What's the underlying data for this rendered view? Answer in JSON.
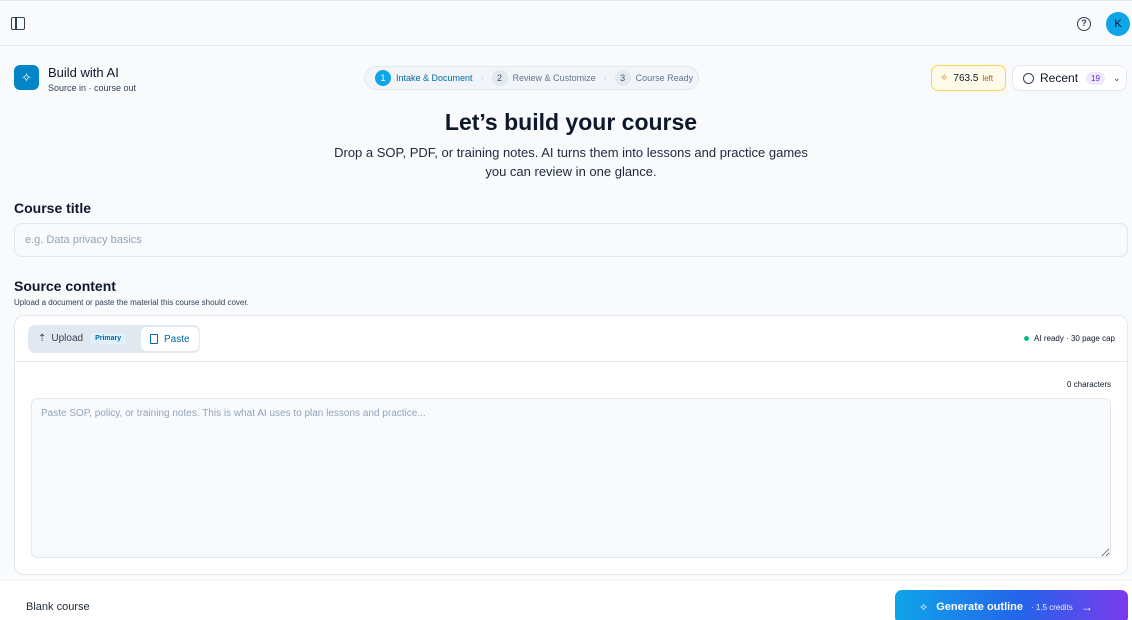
{
  "topbar": {
    "avatar_initial": "K"
  },
  "brand": {
    "title": "Build with AI",
    "subtitle": "Source in · course out"
  },
  "stepper": [
    {
      "num": "1",
      "label": "Intake & Document",
      "active": true
    },
    {
      "num": "2",
      "label": "Review & Customize",
      "active": false
    },
    {
      "num": "3",
      "label": "Course Ready",
      "active": false
    }
  ],
  "credits": {
    "amount": "763.5",
    "suffix": "left"
  },
  "recent": {
    "label": "Recent",
    "count": "19"
  },
  "hero": {
    "title": "Let’s build your course",
    "subtitle": "Drop a SOP, PDF, or training notes. AI turns them into lessons and practice games you can review in one glance."
  },
  "course_title": {
    "label": "Course title",
    "placeholder": "e.g. Data privacy basics",
    "value": ""
  },
  "source": {
    "label": "Source content",
    "hint": "Upload a document or paste the material this course should cover.",
    "upload_label": "Upload",
    "primary_badge": "Primary",
    "paste_label": "Paste",
    "status": "AI ready · 30 page cap",
    "char_count": "0 characters",
    "placeholder": "Paste SOP, policy, or training notes. This is what AI uses to plan lessons and practice...",
    "value": ""
  },
  "footer": {
    "blank_label": "Blank course",
    "generate_label": "Generate outline",
    "generate_cost": "· 1.5 credits"
  },
  "colors": {
    "accent": "#0ea5e9",
    "credits_bg": "#fffbeb",
    "ai_ready": "#10b981"
  },
  "icons": [
    "sidebar-toggle-icon",
    "help-icon",
    "sparkles-icon",
    "history-icon",
    "chevron-down-icon",
    "upload-cloud-icon",
    "file-text-icon",
    "arrow-right-icon"
  ]
}
